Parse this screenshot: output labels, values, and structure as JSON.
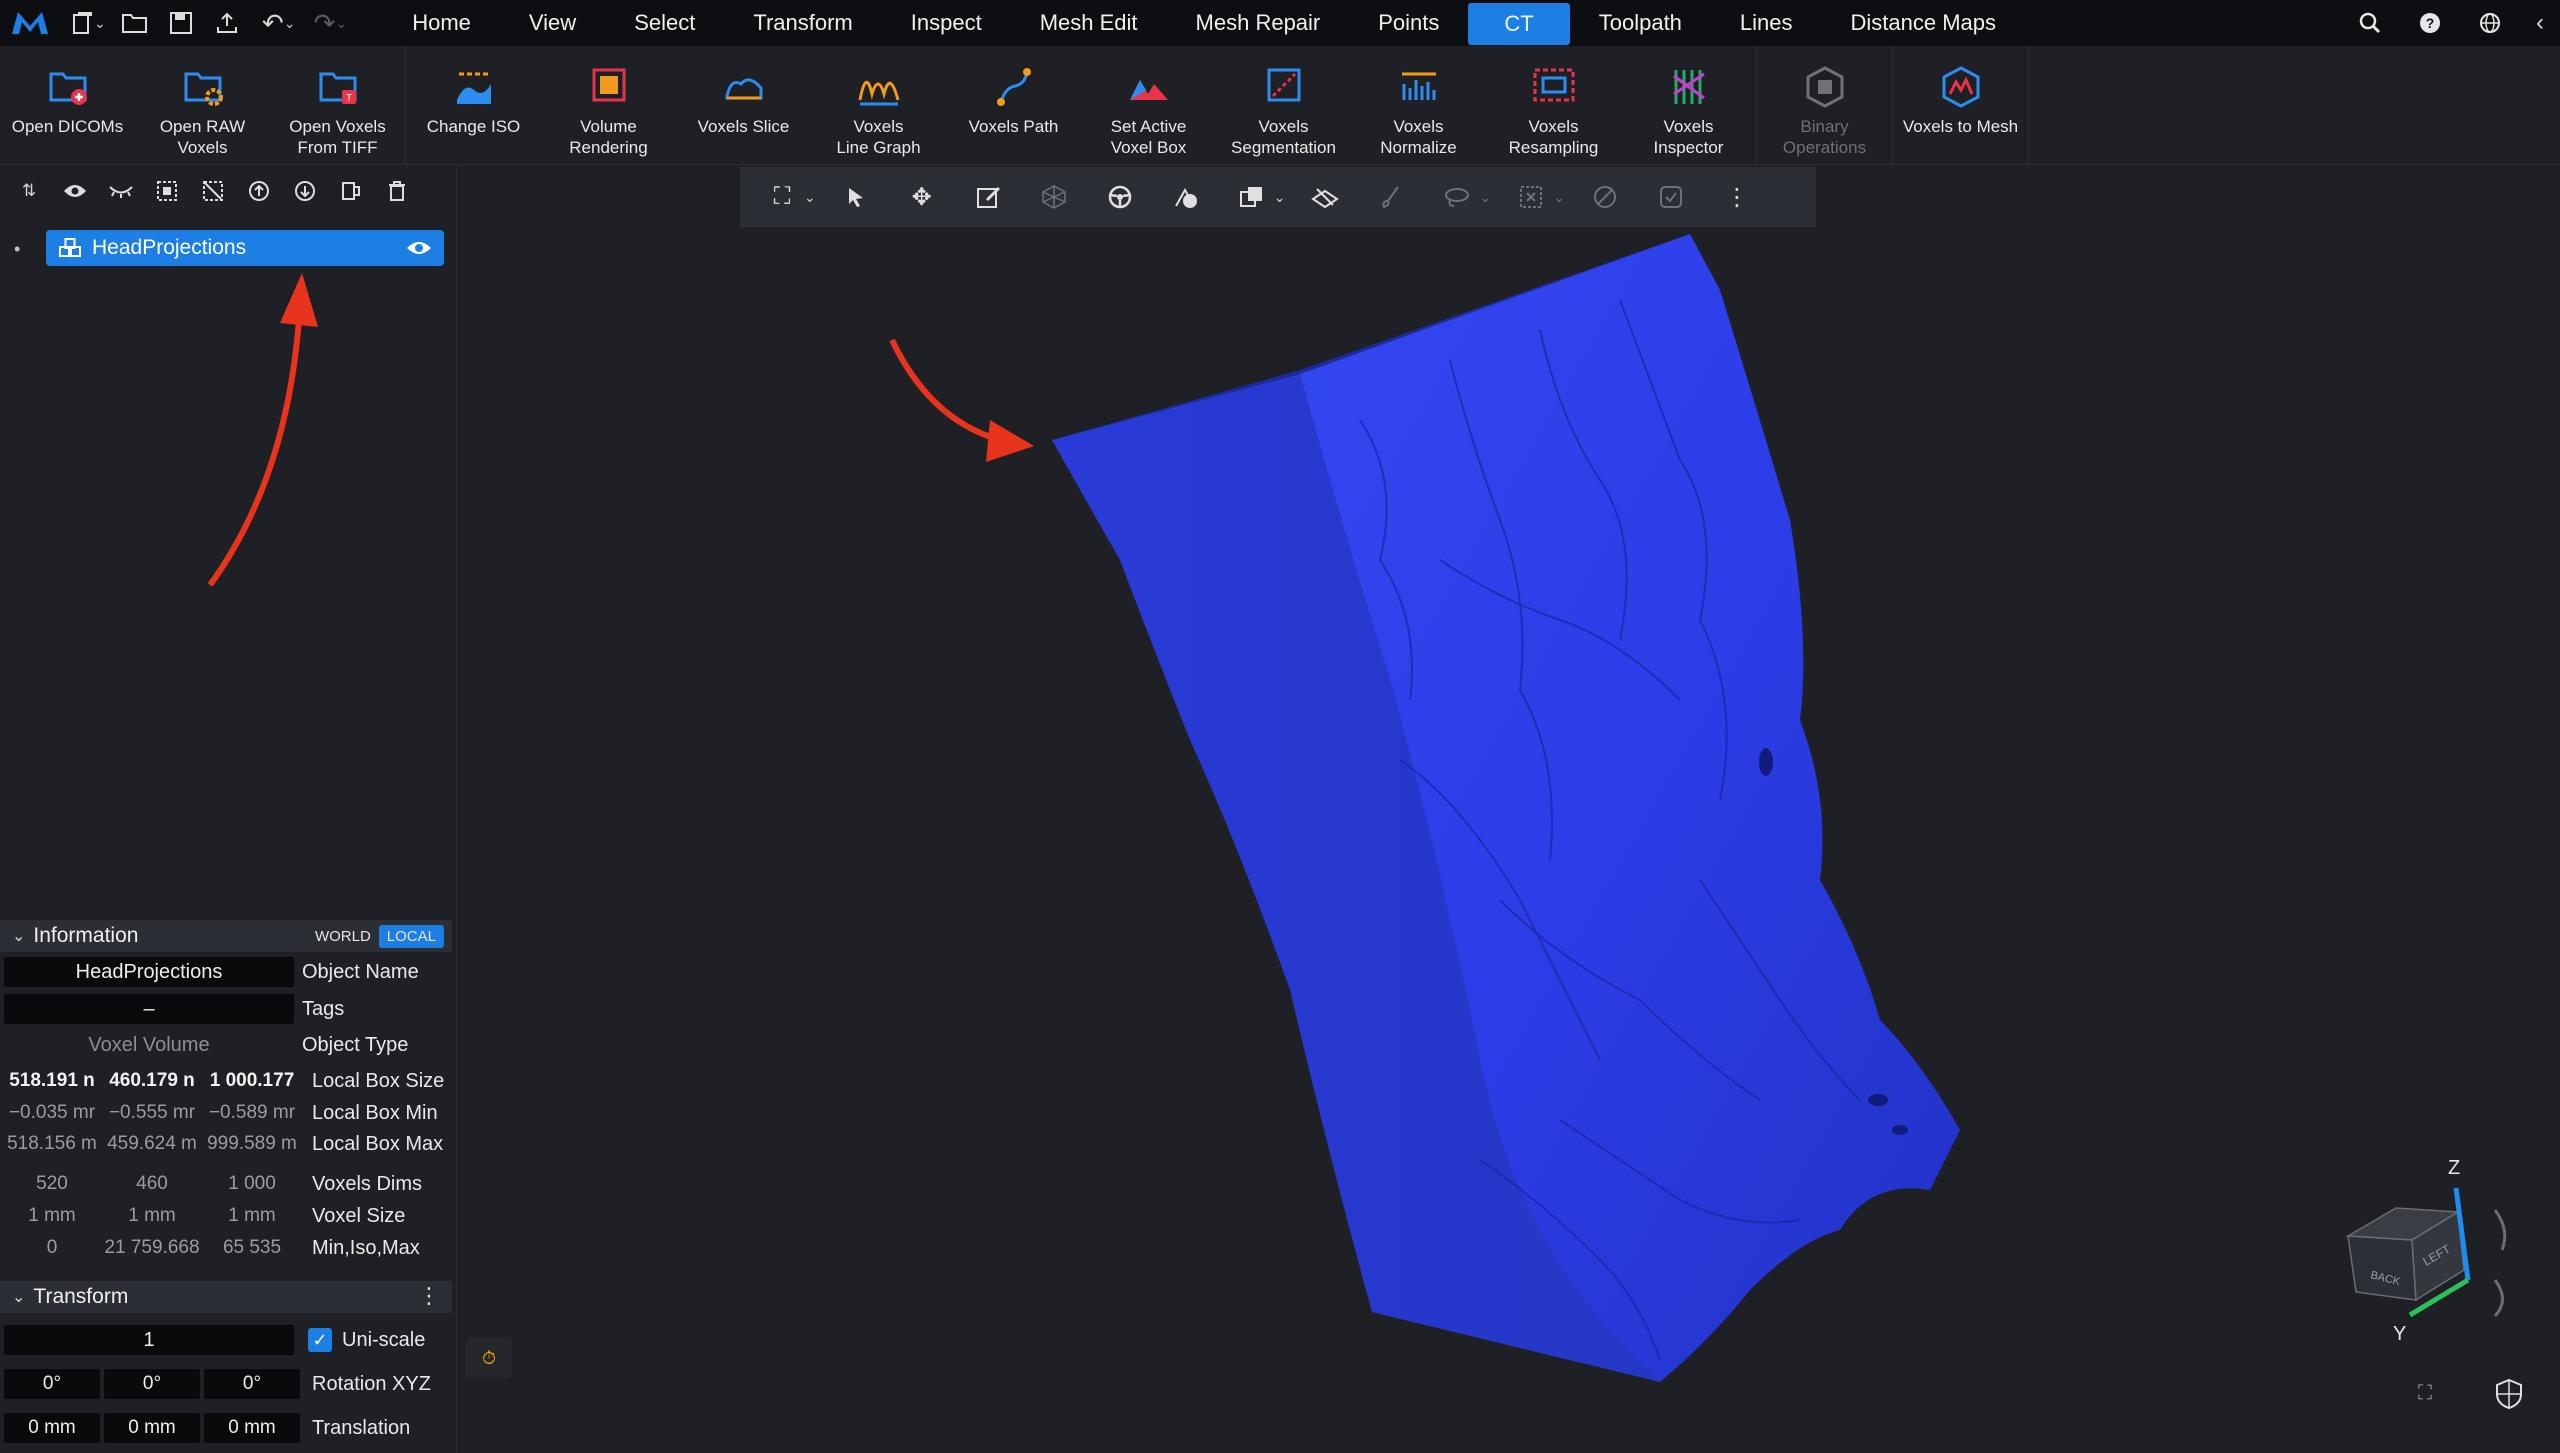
{
  "menubar": {
    "tabs": [
      "Home",
      "View",
      "Select",
      "Transform",
      "Inspect",
      "Mesh Edit",
      "Mesh Repair",
      "Points",
      "CT",
      "Toolpath",
      "Lines",
      "Distance Maps"
    ],
    "active_tab": "CT",
    "accent": "#1d7fe3"
  },
  "ribbon": {
    "buttons": [
      {
        "label": "Open DICOMs",
        "icon": "folder-plus-icon"
      },
      {
        "label": "Open RAW\nVoxels",
        "icon": "folder-gear-icon"
      },
      {
        "label": "Open Voxels\nFrom TIFF",
        "icon": "folder-tiff-icon"
      },
      {
        "label": "Change ISO",
        "icon": "iso-icon"
      },
      {
        "label": "Volume\nRendering",
        "icon": "volume-icon"
      },
      {
        "label": "Voxels Slice",
        "icon": "slice-icon"
      },
      {
        "label": "Voxels\nLine Graph",
        "icon": "line-graph-icon"
      },
      {
        "label": "Voxels Path",
        "icon": "path-icon"
      },
      {
        "label": "Set Active\nVoxel Box",
        "icon": "voxel-box-icon"
      },
      {
        "label": "Voxels\nSegmentation",
        "icon": "segmentation-icon"
      },
      {
        "label": "Voxels\nNormalize",
        "icon": "normalize-icon"
      },
      {
        "label": "Voxels\nResampling",
        "icon": "resampling-icon"
      },
      {
        "label": "Voxels\nInspector",
        "icon": "inspector-icon"
      },
      {
        "label": "Binary\nOperations",
        "icon": "binary-ops-icon"
      },
      {
        "label": "Voxels to Mesh",
        "icon": "voxels-to-mesh-icon"
      }
    ]
  },
  "scene": {
    "object_name": "HeadProjections"
  },
  "info": {
    "title": "Information",
    "world": "WORLD",
    "local": "LOCAL",
    "name_value": "HeadProjections",
    "name_label": "Object Name",
    "tags_value": "–",
    "tags_label": "Tags",
    "type_value": "Voxel Volume",
    "type_label": "Object Type",
    "box_size": [
      "518.191 n",
      "460.179 n",
      "1 000.177"
    ],
    "box_size_label": "Local Box Size",
    "box_min": [
      "−0.035 mr",
      "−0.555 mr",
      "−0.589 mr"
    ],
    "box_min_label": "Local Box Min",
    "box_max": [
      "518.156 m",
      "459.624 m",
      "999.589 m"
    ],
    "box_max_label": "Local Box Max",
    "dims": [
      "520",
      "460",
      "1 000"
    ],
    "dims_label": "Voxels Dims",
    "voxel_size": [
      "1 mm",
      "1 mm",
      "1 mm"
    ],
    "voxel_size_label": "Voxel Size",
    "min_iso_max": [
      "0",
      "21 759.668",
      "65 535"
    ],
    "min_iso_max_label": "Min,Iso,Max"
  },
  "transform": {
    "title": "Transform",
    "scale_value": "1",
    "uniscale_label": "Uni-scale",
    "rotation": [
      "0°",
      "0°",
      "0°"
    ],
    "rotation_label": "Rotation XYZ",
    "translation": [
      "0 mm",
      "0 mm",
      "0 mm"
    ],
    "translation_label": "Translation"
  },
  "viewcube": {
    "z_label": "Z",
    "y_label": "Y",
    "back": "BACK",
    "left": "LEFT"
  },
  "colors": {
    "mesh": "#2b3de6",
    "annotation_arrow": "#e8341c"
  }
}
